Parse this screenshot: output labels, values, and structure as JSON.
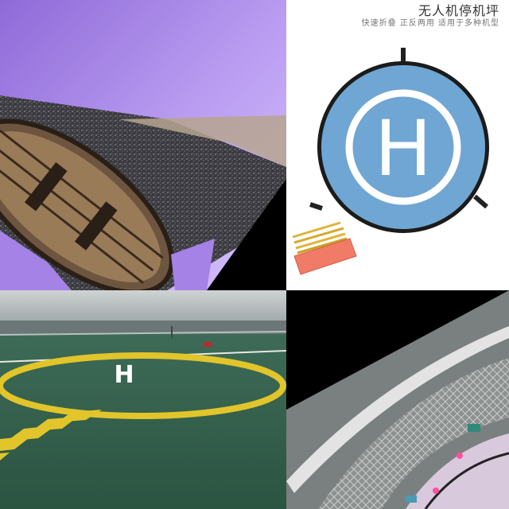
{
  "collage": {
    "top_right": {
      "title": "无人机停机坪",
      "subtitle": "快速折叠   正反两用   适用于多种机型",
      "pad_letter": "H"
    },
    "bottom_left": {
      "pad_letter": "H"
    },
    "colors": {
      "pad_blue": "#6fa6d3",
      "pad_ring": "#1b1b1b",
      "deck_green": "#2f5a47",
      "deck_yellow": "#e2c52b",
      "purple_rock": "#a482e6",
      "wood": "#8b6f4e"
    }
  }
}
